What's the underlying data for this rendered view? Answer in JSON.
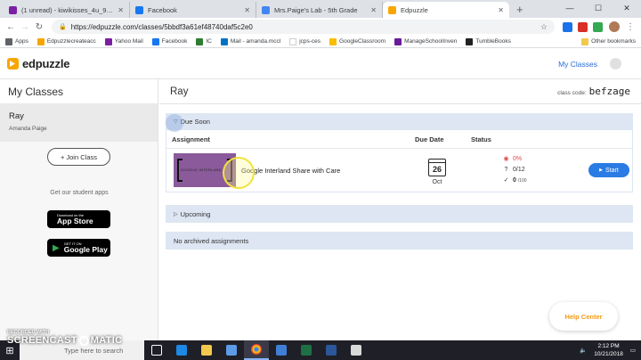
{
  "browser": {
    "tabs": [
      {
        "title": "(1 unread) - kiwikisses_4u_99@y",
        "color": "#7b1fa2"
      },
      {
        "title": "Facebook",
        "color": "#1877f2"
      },
      {
        "title": "Mrs.Paige's Lab - 5th Grade",
        "color": "#4285f4"
      },
      {
        "title": "Edpuzzle",
        "color": "#f7a600"
      }
    ],
    "url": "https://edpuzzle.com/classes/5bbdf3a61ef48740daf5c2e0",
    "bookmarks": [
      "Apps",
      "Edpuzzlecreateacc",
      "Yahoo Mail",
      "Facebook",
      "IC",
      "Mail - amanda.mccl",
      "jcps-ces",
      "GoogleClassroom",
      "ManageSchoolInven",
      "TumbleBooks"
    ],
    "other_bookmarks": "Other bookmarks"
  },
  "header": {
    "logo_text": "edpuzzle",
    "my_classes_link": "My Classes"
  },
  "sidebar": {
    "title": "My Classes",
    "class": {
      "name": "Ray",
      "teacher": "Amanda Paige"
    },
    "join_button": "Join Class",
    "apps_label": "Get our student apps",
    "app_store": {
      "small": "Download on the",
      "big": "App Store"
    },
    "google_play": {
      "small": "GET IT ON",
      "big": "Google Play"
    }
  },
  "main": {
    "title": "Ray",
    "class_code_label": "class code:",
    "class_code": "befzage",
    "due_soon": {
      "label": "Due Soon",
      "columns": {
        "assignment": "Assignment",
        "due_date": "Due Date",
        "status": "Status"
      },
      "assignments": [
        {
          "thumb_text": "GOOGLE INTERLAND",
          "name": "Google Interland Share with Care",
          "due_day": "26",
          "due_month": "Oct",
          "watched": "0%",
          "questions": "0/12",
          "score": "0",
          "score_of": "/100",
          "start_label": "Start"
        }
      ]
    },
    "upcoming_label": "Upcoming",
    "archived_label": "No archived assignments"
  },
  "help_center": "Help Center",
  "taskbar": {
    "search_placeholder": "Type here to search",
    "time": "2:12 PM",
    "date": "10/21/2018"
  },
  "watermark": {
    "recorded": "RECORDED WITH",
    "brand_left": "SCREENCAST",
    "brand_right": "MATIC"
  }
}
